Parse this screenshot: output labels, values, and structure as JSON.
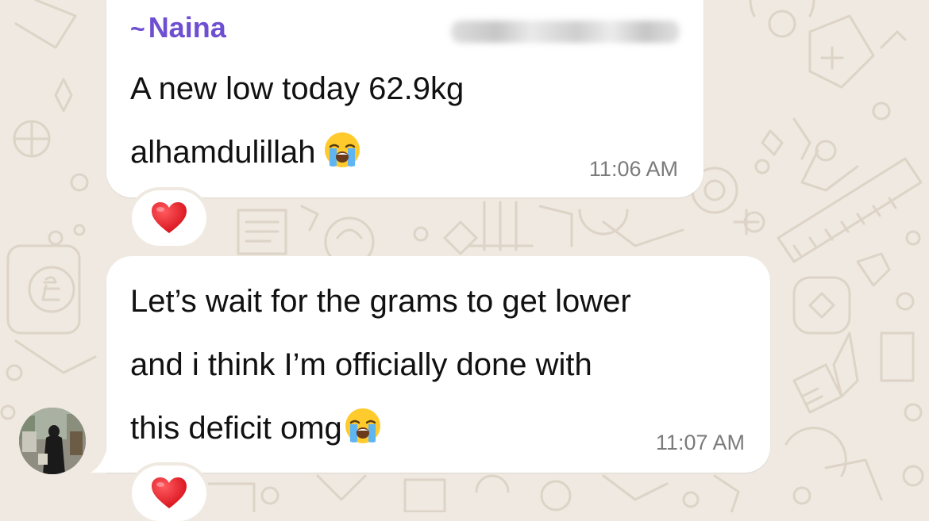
{
  "chat": {
    "messages": [
      {
        "sender": "Naina",
        "sender_prefix": "~",
        "lines": [
          "A new low today 62.9kg",
          "alhamdulillah"
        ],
        "emoji": "loudly-crying-face-icon",
        "time": "11:06 AM",
        "reaction": "red-heart-icon"
      },
      {
        "lines": [
          "Let’s wait for the grams to get lower",
          "and i think I’m officially done with",
          "this deficit omg"
        ],
        "emoji": "loudly-crying-face-icon",
        "time": "11:07 AM",
        "reaction": "red-heart-icon"
      }
    ]
  },
  "colors": {
    "background": "#efe9e1",
    "bubble": "#ffffff",
    "sender_name": "#6e4fd2",
    "timestamp": "#7b7b7b",
    "heart": "#e0242c"
  }
}
